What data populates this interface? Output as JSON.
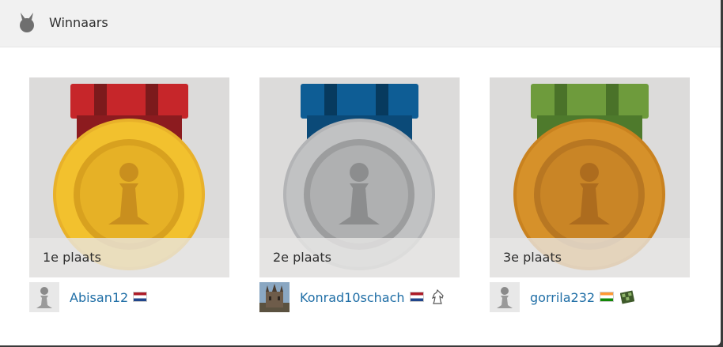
{
  "header": {
    "title": "Winnaars",
    "icon": "medal-icon"
  },
  "winners": [
    {
      "place": "1e plaats",
      "username": "Abisan12",
      "medal": "gold",
      "avatar": "pawn-avatar",
      "flag": "netherlands-flag",
      "colors": {
        "ribbon": "#c6262a",
        "ribbon_dark": "#7c1a1c",
        "medal": "#f2c12e",
        "medal_inner": "#d8a11f"
      }
    },
    {
      "place": "2e plaats",
      "username": "Konrad10schach",
      "medal": "silver",
      "avatar": "castle-photo-avatar",
      "flag": "netherlands-flag",
      "badge": "knight-icon",
      "colors": {
        "ribbon": "#0e5d95",
        "ribbon_dark": "#073a5e",
        "medal": "#c1c2c3",
        "medal_inner": "#9c9d9e"
      }
    },
    {
      "place": "3e plaats",
      "username": "gorrila232",
      "medal": "bronze",
      "avatar": "pawn-avatar",
      "flag": "india-flag",
      "badge": "board-icon",
      "colors": {
        "ribbon": "#6e9b3c",
        "ribbon_dark": "#4a7229",
        "medal": "#d6912a",
        "medal_inner": "#b87722"
      }
    }
  ]
}
